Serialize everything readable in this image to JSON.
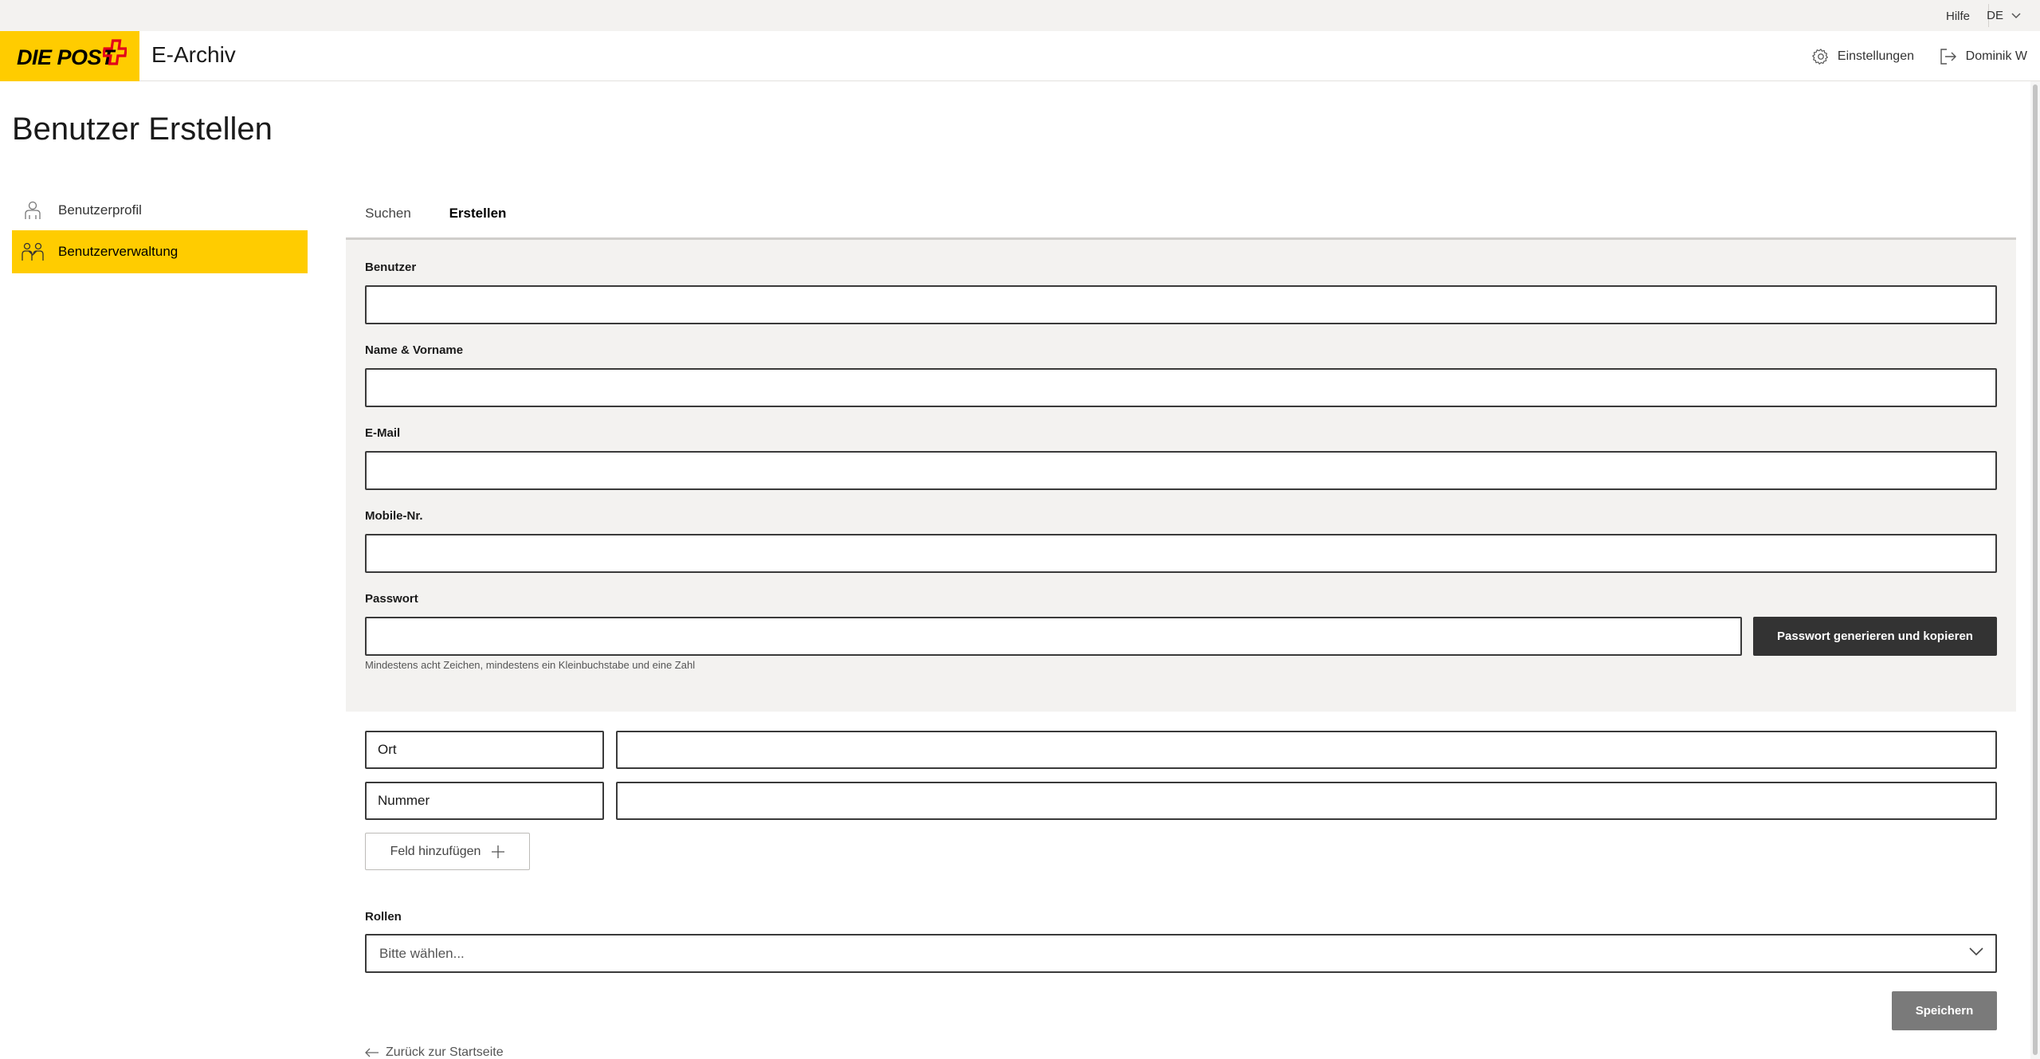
{
  "utility": {
    "help": "Hilfe",
    "language": "DE"
  },
  "header": {
    "logo_text": "DIE POST",
    "app_name": "E-Archiv",
    "settings_label": "Einstellungen",
    "user_label": "Dominik W"
  },
  "page": {
    "title": "Benutzer Erstellen"
  },
  "sidebar": {
    "items": [
      {
        "label": "Benutzerprofil",
        "icon": "user-icon",
        "active": false
      },
      {
        "label": "Benutzerverwaltung",
        "icon": "users-icon",
        "active": true
      }
    ]
  },
  "tabs": [
    {
      "label": "Suchen",
      "active": false
    },
    {
      "label": "Erstellen",
      "active": true
    }
  ],
  "form": {
    "user": {
      "label": "Benutzer",
      "value": ""
    },
    "name": {
      "label": "Name & Vorname",
      "value": ""
    },
    "email": {
      "label": "E-Mail",
      "value": ""
    },
    "mobile": {
      "label": "Mobile-Nr.",
      "value": ""
    },
    "password": {
      "label": "Passwort",
      "value": "",
      "button": "Passwort generieren und kopieren",
      "hint": "Mindestens acht Zeichen, mindestens ein Kleinbuchstabe und eine Zahl"
    }
  },
  "custom_fields": [
    {
      "key": "Ort",
      "value": ""
    },
    {
      "key": "Nummer",
      "value": ""
    }
  ],
  "add_field_label": "Feld hinzufügen",
  "roles": {
    "label": "Rollen",
    "placeholder": "Bitte wählen..."
  },
  "save_label": "Speichern",
  "back_label": "Zurück zur Startseite",
  "colors": {
    "brand_yellow": "#ffcc00",
    "dark_button": "#333333",
    "disabled_button": "#7a7a7a",
    "panel_bg": "#f3f2f0"
  }
}
